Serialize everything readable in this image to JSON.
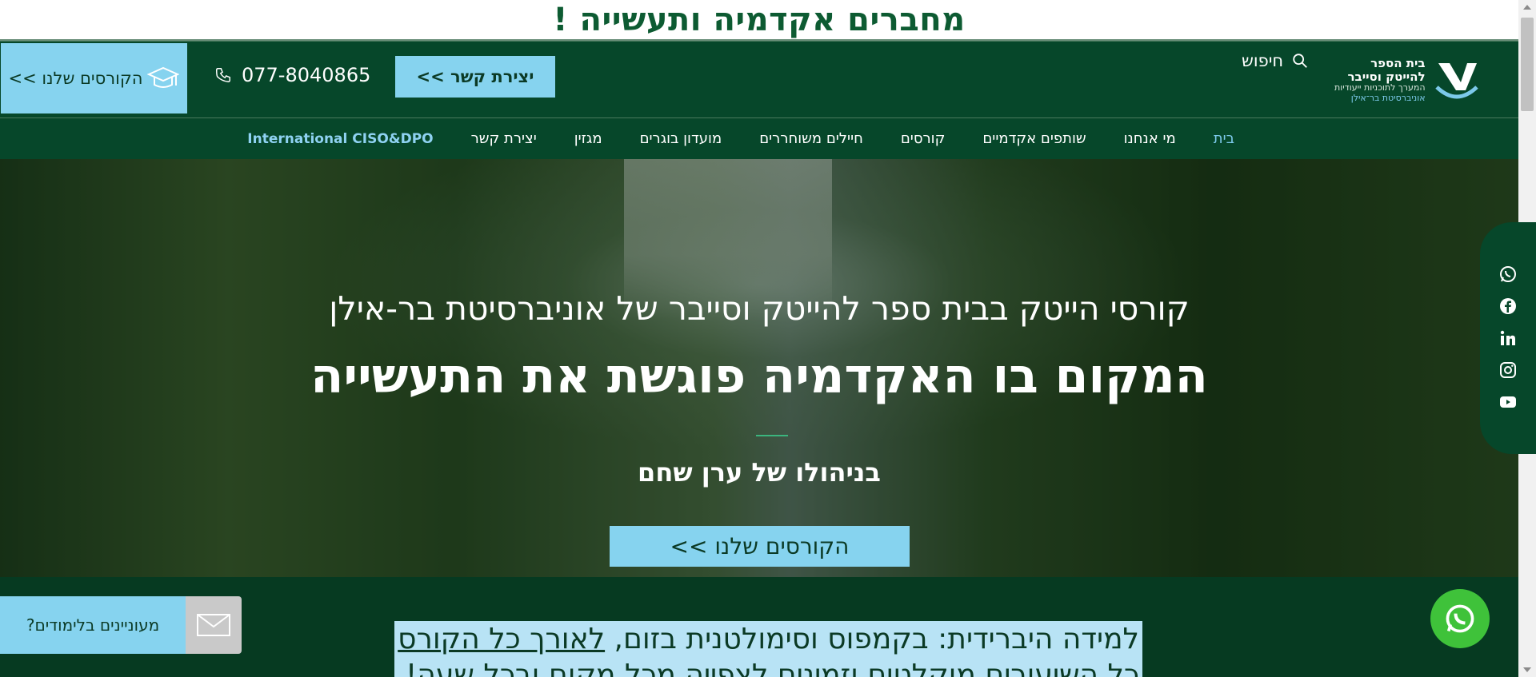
{
  "banner": {
    "title": "מחברים אקדמיה ותעשייה !"
  },
  "header": {
    "courses_cta": "הקורסים שלנו >>",
    "phone": "077-8040865",
    "contact_button": "יצירת קשר >>",
    "search_label": "חיפוש",
    "logo": {
      "line1": "בית הספר",
      "line2": "להייטק וסייבר",
      "line3": "המערך לתוכניות ייעודיות",
      "line4": "אוניברסיטת בר־אילן"
    }
  },
  "nav": {
    "items": [
      {
        "label": "בית",
        "active": true
      },
      {
        "label": "מי אנחנו"
      },
      {
        "label": "שותפים אקדמיים"
      },
      {
        "label": "קורסים"
      },
      {
        "label": "חיילים משוחררים"
      },
      {
        "label": "מועדון בוגרים"
      },
      {
        "label": "מגזין"
      },
      {
        "label": "יצירת קשר"
      },
      {
        "label": "International CISO&DPO"
      }
    ]
  },
  "hero": {
    "subtitle": "קורסי הייטק בבית ספר להייטק וסייבר של אוניברסיטת בר-אילן",
    "title": "המקום בו האקדמיה פוגשת את התעשייה",
    "author": "בניהולו של ערן שחם",
    "button": "הקורסים שלנו >>"
  },
  "social": [
    "whatsapp-icon",
    "facebook-icon",
    "linkedin-icon",
    "instagram-icon",
    "youtube-icon"
  ],
  "lower": {
    "line1_prefix": "למידה היברידית:  בקמפוס וסימולטנית בזום, ",
    "line1_link": "לאורך כל הקורס",
    "line2": "כל השיעורים מוקלטים וזמינים לצפייה מכל מקום ובכל שעה!"
  },
  "interest": {
    "label": "מעוניינים בלימודים?"
  },
  "colors": {
    "primary": "#06472a",
    "accent": "#86d3ef",
    "whatsapp": "#3fc23a"
  }
}
